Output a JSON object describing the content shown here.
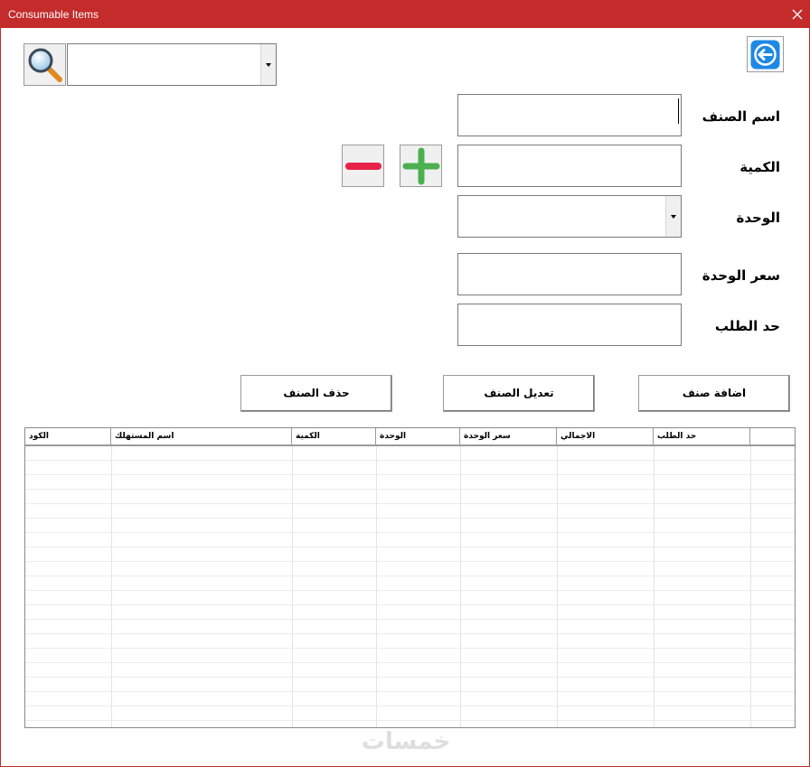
{
  "window": {
    "title": "Consumable Items"
  },
  "search": {
    "value": ""
  },
  "form": {
    "item_name_label": "اسم الصنف",
    "quantity_label": "الكمية",
    "unit_label": "الوحدة",
    "unit_price_label": "سعر الوحدة",
    "reorder_label": "حد الطلب",
    "item_name_value": "",
    "quantity_value": "",
    "unit_value": "",
    "unit_price_value": "",
    "reorder_value": ""
  },
  "actions": {
    "add_label": "اضافة صنف",
    "edit_label": "تعديل الصنف",
    "delete_label": "حذف الصنف"
  },
  "table": {
    "columns": [
      "الكود",
      "اسم المستهلك",
      "الكمية",
      "الوحدة",
      "سعر الوحدة",
      "الاجمالي",
      "حد الطلب"
    ],
    "rows": []
  },
  "watermark": "خمسات",
  "icons": {
    "search": "magnifier-icon",
    "back": "arrow-left-icon",
    "plus": "plus-icon",
    "minus": "minus-icon",
    "close": "close-icon"
  },
  "colors": {
    "titlebar": "#c42b2b",
    "back_button": "#1e88e5",
    "plus": "#4caf50",
    "minus": "#e8234a"
  }
}
